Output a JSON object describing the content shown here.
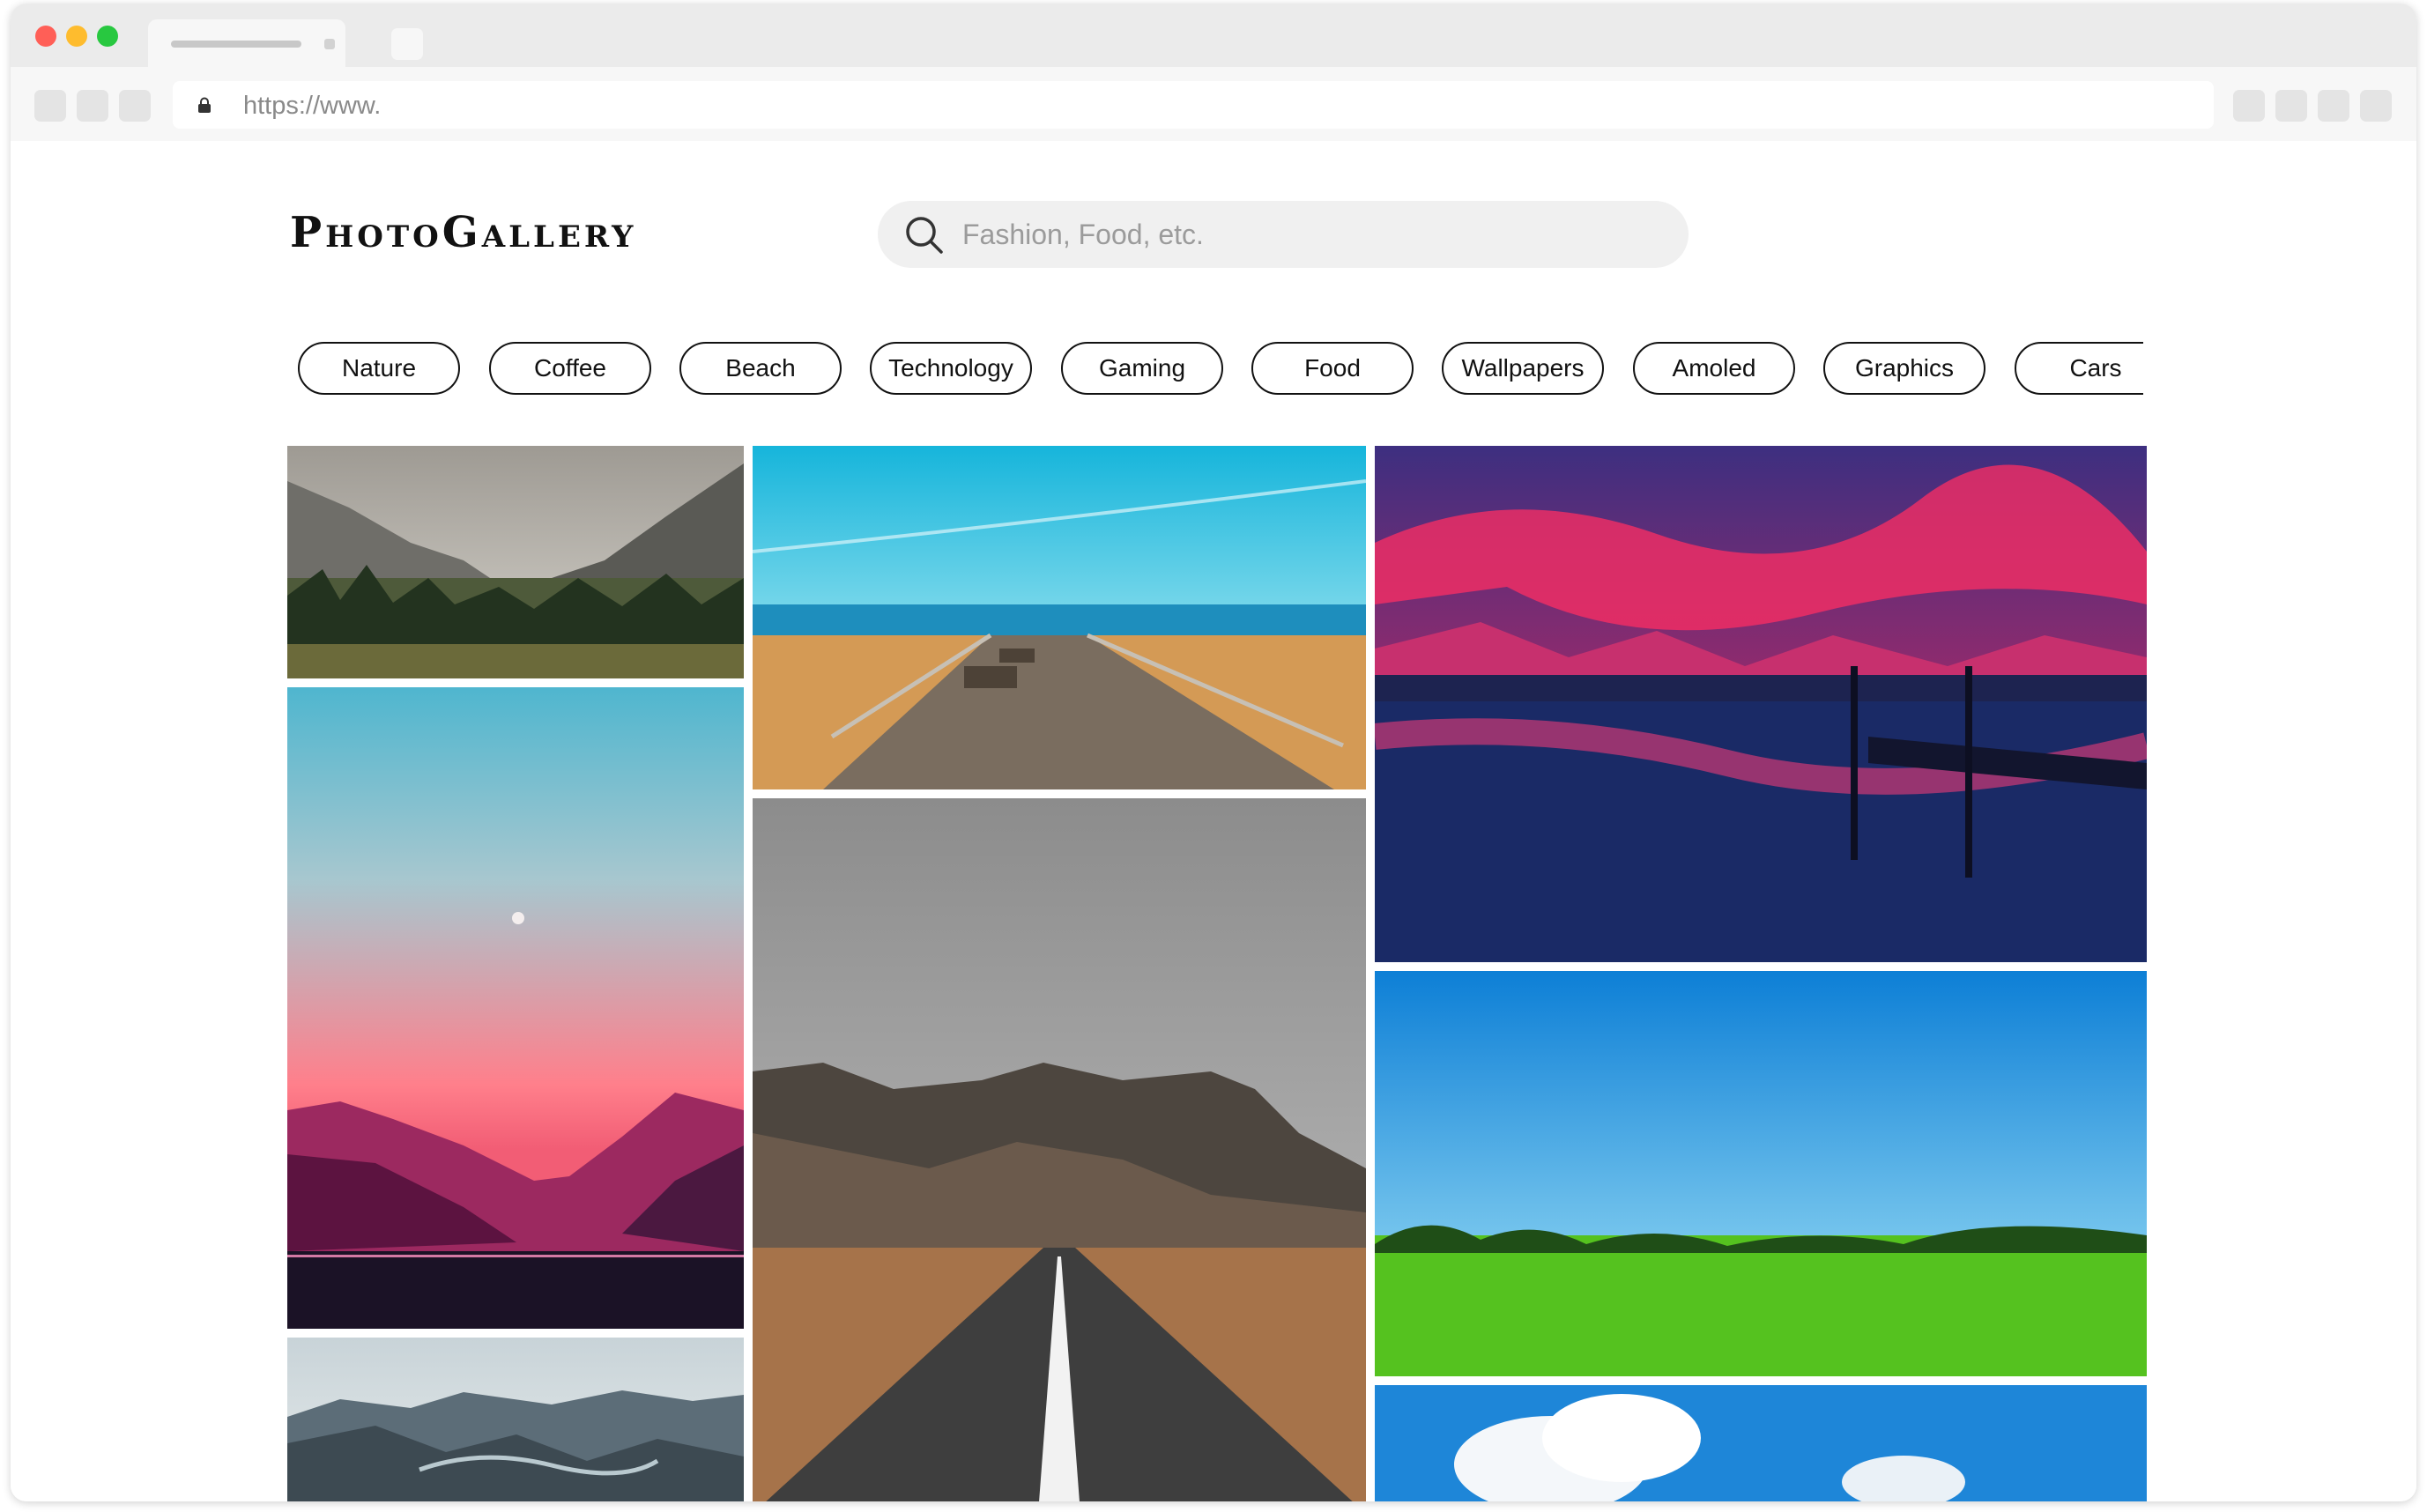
{
  "browser": {
    "url": "https://www."
  },
  "header": {
    "logo": "PhotoGallery",
    "search_placeholder": "Fashion, Food, etc.",
    "search_value": ""
  },
  "categories": [
    "Nature",
    "Coffee",
    "Beach",
    "Technology",
    "Gaming",
    "Food",
    "Wallpapers",
    "Amoled",
    "Graphics",
    "Cars"
  ],
  "icons": {
    "search": "search-icon",
    "lock": "lock-icon"
  },
  "colors": {
    "chip_border": "#111111",
    "search_bg": "#f0f0f0"
  }
}
